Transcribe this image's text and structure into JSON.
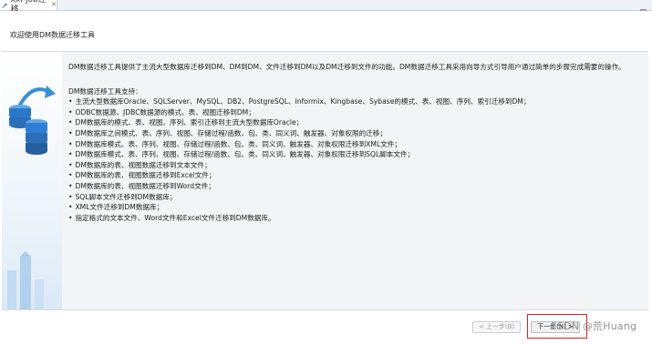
{
  "tab": {
    "title": "xxl-job迁移",
    "close": "✕"
  },
  "header": {
    "title": "欢迎使用DM数据迁移工具"
  },
  "content": {
    "intro": "DM数据迁移工具提供了主流大型数据库迁移到DM、DM到DM、文件迁移到DM以及DM迁移到文件的功能。DM数据迁移工具采用向导方式引导用户通过简单的步骤完成需要的操作。",
    "support_label": "DM数据迁移工具支持：",
    "features": [
      "主流大型数据库Oracle、SQLServer、MySQL、DB2、PostgreSQL、Informix、Kingbase、Sybase的模式、表、视图、序列、索引迁移到DM；",
      "ODBC数据源、JDBC数据源的模式、表、视图迁移到DM；",
      "DM数据库的模式、表、视图、序列、索引迁移到主流大型数据库Oracle；",
      "DM数据库之间模式、表、序列、视图、存储过程/函数、包、类、同义词、触发器、对象权限的迁移；",
      "DM数据库模式、表、序列、视图、存储过程/函数、包、类、同义词、触发器、对象权限迁移到XML文件；",
      "DM数据库模式、表、序列、视图、存储过程/函数、包、类、同义词、触发器、对象权限迁移到SQL脚本文件；",
      "DM数据库的表、视图数据迁移到文本文件；",
      "DM数据库的表、视图数据迁移到Excel文件；",
      "DM数据库的表、视图数据迁移到Word文件；",
      "SQL脚本文件迁移到DM数据库；",
      "XML文件迁移到DM数据库；",
      "指定格式的文本文件、Word文件和Excel文件迁移到DM数据库。"
    ]
  },
  "footer": {
    "prev_label": "< 上一步(B)",
    "next_label": "下一步(N) >",
    "watermark": "CSDN @荒Huang"
  },
  "colors": {
    "highlight": "#e02020",
    "accent": "#2f7fd6"
  },
  "icons": [
    "database-icon",
    "arrow-icon",
    "close-icon",
    "minimize-icon",
    "maximize-icon"
  ]
}
